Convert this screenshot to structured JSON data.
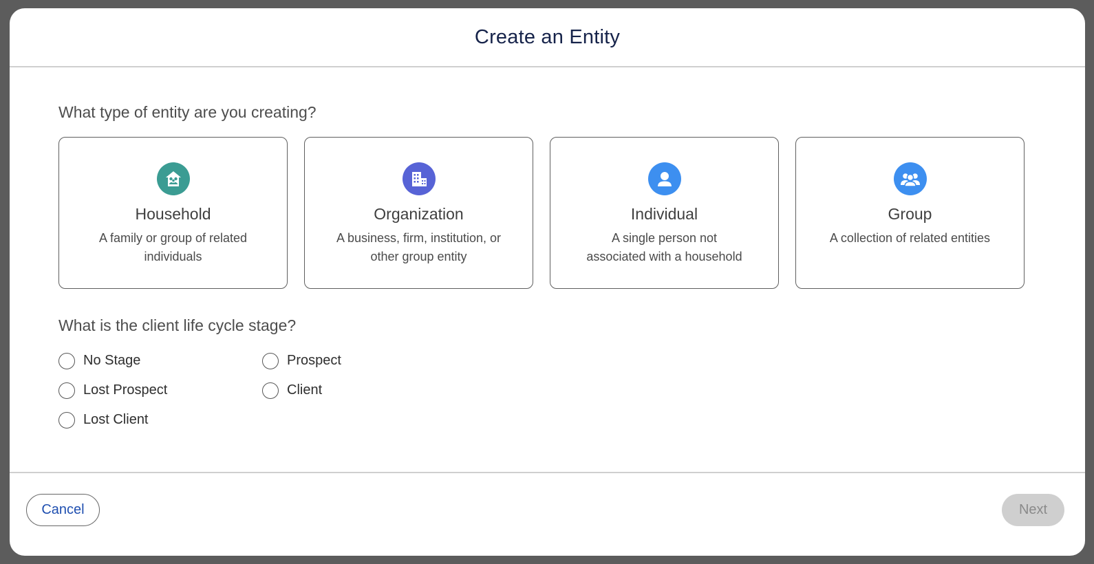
{
  "modal": {
    "title": "Create an Entity"
  },
  "entity_question": "What type of entity are you creating?",
  "entity_types": [
    {
      "title": "Household",
      "description": "A family or group of related individuals",
      "icon": "household-icon",
      "color": "#3b9c93"
    },
    {
      "title": "Organization",
      "description": "A business, firm, institution, or other group entity",
      "icon": "building-icon",
      "color": "#5763d6"
    },
    {
      "title": "Individual",
      "description": "A single person not associated with a household",
      "icon": "person-icon",
      "color": "#3d8ff0"
    },
    {
      "title": "Group",
      "description": "A collection of related entities",
      "icon": "group-icon",
      "color": "#3d8ff0"
    }
  ],
  "stage_question": "What is the client life cycle stage?",
  "stages": [
    {
      "label": "No Stage"
    },
    {
      "label": "Prospect"
    },
    {
      "label": "Lost Prospect"
    },
    {
      "label": "Client"
    },
    {
      "label": "Lost Client"
    }
  ],
  "footer": {
    "cancel_label": "Cancel",
    "next_label": "Next"
  }
}
